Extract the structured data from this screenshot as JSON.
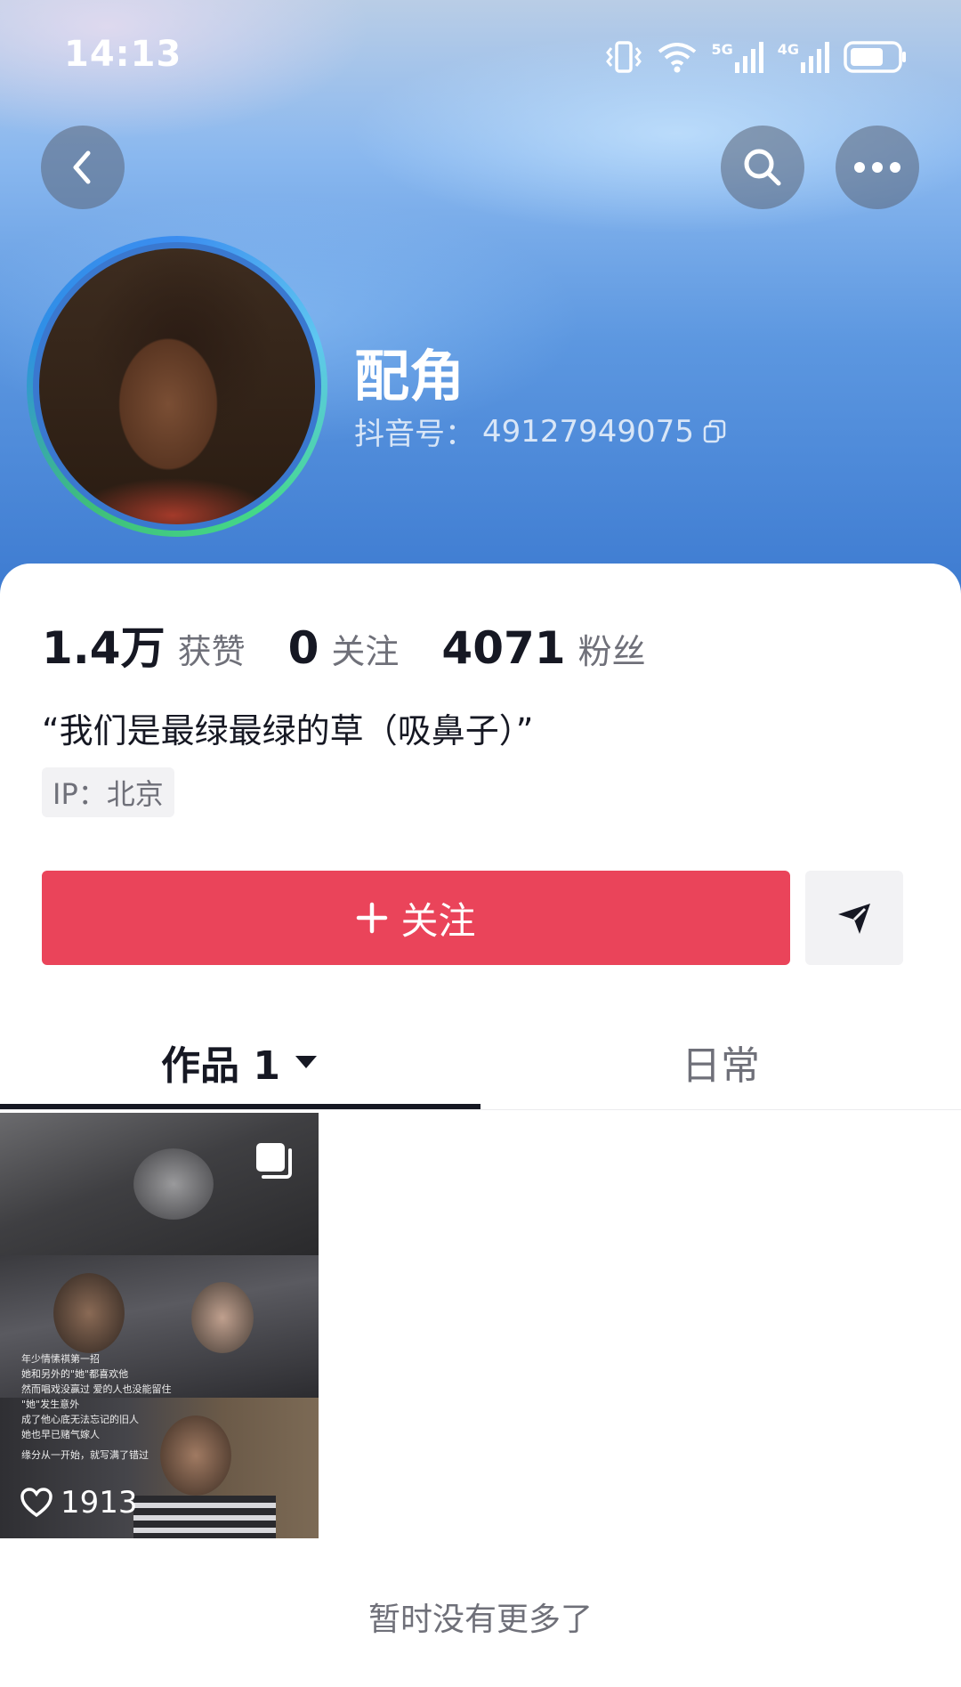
{
  "status_bar": {
    "time": "14:13",
    "net1": "5G",
    "net2": "4G"
  },
  "nav": {
    "back_icon": "chevron-left-icon",
    "search_icon": "search-icon",
    "more_icon": "more-icon"
  },
  "profile": {
    "name": "配角",
    "douyin_id_label": "抖音号：",
    "douyin_id": "49127949075"
  },
  "stats": [
    {
      "value": "1.4万",
      "label": "获赞"
    },
    {
      "value": "0",
      "label": "关注"
    },
    {
      "value": "4071",
      "label": "粉丝"
    }
  ],
  "bio": "“我们是最绿最绿的草（吸鼻子）”",
  "ip": "IP：北京",
  "actions": {
    "follow_label": "关注",
    "accent": "#ea445a"
  },
  "tabs": {
    "works": "作品 1",
    "daily": "日常"
  },
  "video": {
    "likes": "1913",
    "caption_lines": [
      "年少情愫祺第一招",
      "她和另外的\"她\"都喜欢他",
      "然而唱戏没赢过 爱的人也没能留住",
      "\"她\"发生意外",
      "成了他心底无法忘记的旧人",
      "她也早已赌气嫁人",
      "缘分从一开始，就写满了错过"
    ]
  },
  "footer": {
    "end_text": "暂时没有更多了"
  }
}
